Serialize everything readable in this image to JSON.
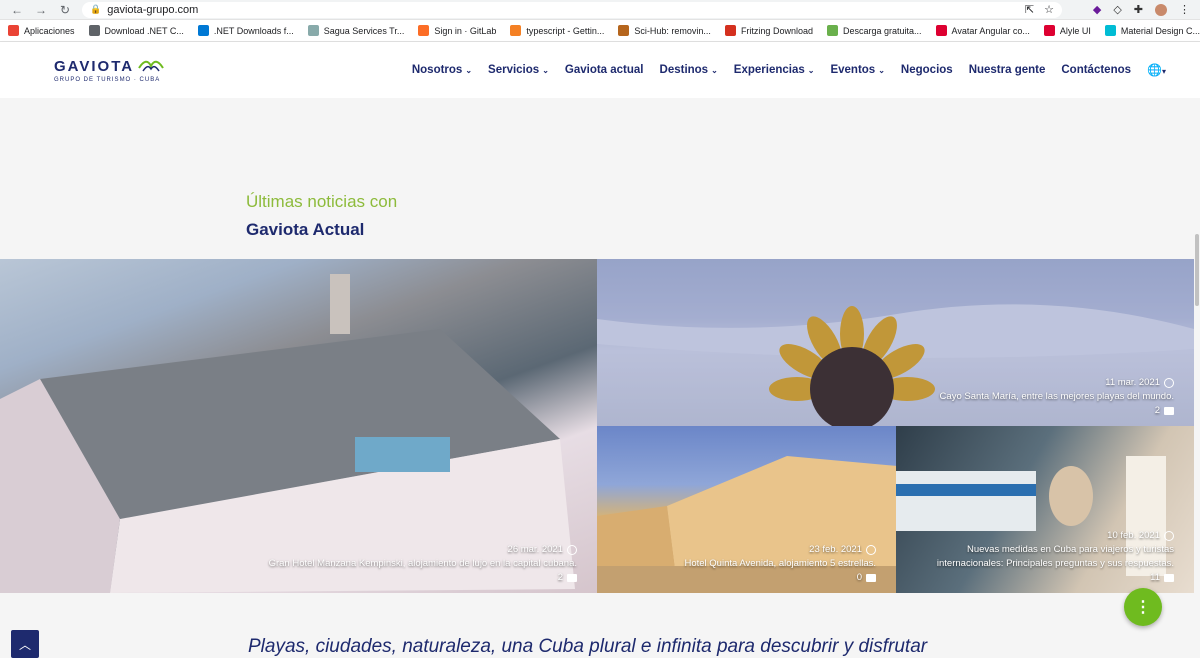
{
  "browser": {
    "url": "gaviota-grupo.com",
    "bookmarks": [
      {
        "label": "Aplicaciones",
        "icon": "apps-icon",
        "color": "#ea4335"
      },
      {
        "label": "Download .NET C...",
        "icon": "globe-icon",
        "color": "#5f6368"
      },
      {
        "label": ".NET Downloads f...",
        "icon": "windows-icon",
        "color": "#0078d4"
      },
      {
        "label": "Sagua Services Tr...",
        "icon": "sagua-icon",
        "color": "#8aa"
      },
      {
        "label": "Sign in · GitLab",
        "icon": "gitlab-icon",
        "color": "#fc6d26"
      },
      {
        "label": "typescript - Gettin...",
        "icon": "stackoverflow-icon",
        "color": "#f48024"
      },
      {
        "label": "Sci-Hub: removin...",
        "icon": "scihub-icon",
        "color": "#b5651d"
      },
      {
        "label": "Fritzing Download",
        "icon": "fritzing-icon",
        "color": "#d4301f"
      },
      {
        "label": "Descarga gratuita...",
        "icon": "download-icon",
        "color": "#6ab04c"
      },
      {
        "label": "Avatar Angular co...",
        "icon": "angular-icon",
        "color": "#dd0031"
      },
      {
        "label": "Alyle UI",
        "icon": "angular-icon",
        "color": "#dd0031"
      },
      {
        "label": "Material Design C...",
        "icon": "material-icon",
        "color": "#00bcd4"
      }
    ],
    "more": "»"
  },
  "header": {
    "logo": {
      "name": "GAVIOTA",
      "subtitle": "GRUPO DE TURISMO · CUBA"
    },
    "menu": [
      {
        "label": "Nosotros",
        "dropdown": true
      },
      {
        "label": "Servicios",
        "dropdown": true
      },
      {
        "label": "Gaviota actual",
        "dropdown": false
      },
      {
        "label": "Destinos",
        "dropdown": true
      },
      {
        "label": "Experiencias",
        "dropdown": true
      },
      {
        "label": "Eventos",
        "dropdown": true
      },
      {
        "label": "Negocios",
        "dropdown": false
      },
      {
        "label": "Nuestra gente",
        "dropdown": false
      },
      {
        "label": "Contáctenos",
        "dropdown": false
      }
    ]
  },
  "news": {
    "kicker": "Últimas noticias con",
    "title": "Gaviota Actual",
    "cards": [
      {
        "date": "26 mar. 2021",
        "text": "Gran Hotel Manzana Kempinski, alojamiento de lujo en la capital cubana.",
        "comments": "2"
      },
      {
        "date": "11 mar. 2021",
        "text": "Cayo Santa María, entre las mejores playas del mundo.",
        "comments": "2"
      },
      {
        "date": "23 feb. 2021",
        "text": "Hotel Quinta Avenida, alojamiento 5 estrellas.",
        "comments": "0"
      },
      {
        "date": "10 feb. 2021",
        "text": "Nuevas medidas en Cuba para viajeros y turistas internacionales: Principales preguntas y sus respuestas.",
        "comments": "11"
      }
    ]
  },
  "slogan": "Playas, ciudades, naturaleza, una Cuba plural e infinita para descubrir y disfrutar",
  "colors": {
    "brand": "#1e2a6e",
    "accent": "#8dbb3b",
    "fab": "#6fbb1f"
  }
}
